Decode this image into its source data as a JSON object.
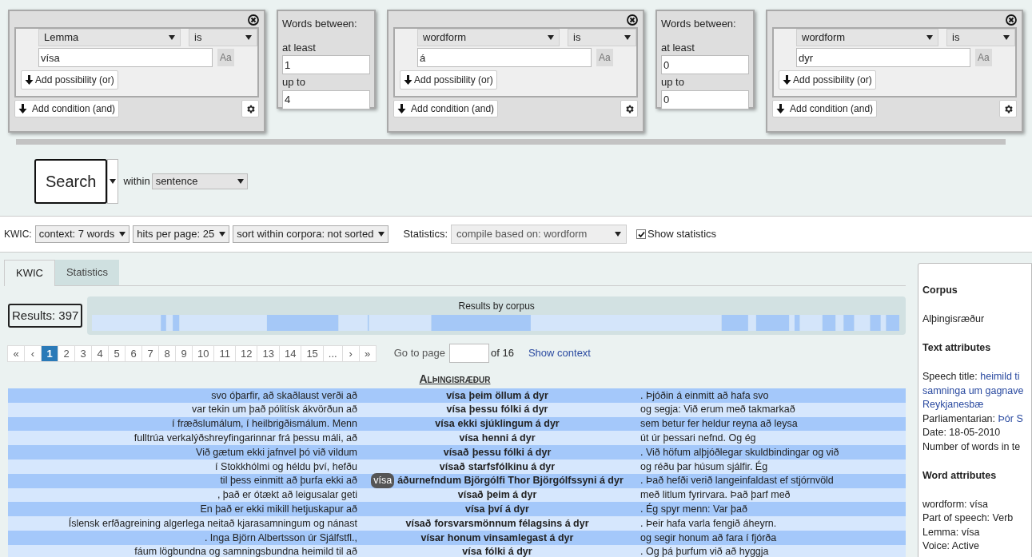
{
  "query": {
    "blocks": [
      {
        "kind": "token",
        "attribute": "Lemma",
        "operator": "is",
        "value": "vísa",
        "case_button": "Aa",
        "add_or": "Add possibility (or)",
        "add_and": "Add condition (and)"
      },
      {
        "kind": "between",
        "title": "Words between:",
        "min_label": "at least",
        "min": "1",
        "max_label": "up to",
        "max": "4"
      },
      {
        "kind": "token",
        "attribute": "wordform",
        "operator": "is",
        "value": "á",
        "case_button": "Aa",
        "add_or": "Add possibility (or)",
        "add_and": "Add condition (and)"
      },
      {
        "kind": "between",
        "title": "Words between:",
        "min_label": "at least",
        "min": "0",
        "max_label": "up to",
        "max": "0"
      },
      {
        "kind": "token",
        "attribute": "wordform",
        "operator": "is",
        "value": "dyr",
        "case_button": "Aa",
        "add_or": "Add possibility (or)",
        "add_and": "Add condition (and)"
      }
    ]
  },
  "search": {
    "button": "Search",
    "within_label": "within",
    "within": "sentence"
  },
  "toolbar": {
    "kwic_label": "KWIC:",
    "options": [
      "context: 7 words",
      "hits per page: 25",
      "sort within corpora: not sorted"
    ],
    "stats_label": "Statistics:",
    "stats_select": "compile based on: wordform",
    "show_stats": {
      "label": "Show statistics",
      "checked": true
    }
  },
  "tabs": [
    {
      "label": "KWIC",
      "selected": true
    },
    {
      "label": "Statistics",
      "selected": false
    }
  ],
  "results_count": "Results: 397",
  "corpus_bar_title": "Results by corpus",
  "pagination": {
    "pages": [
      {
        "label": "«",
        "selected": false
      },
      {
        "label": "‹",
        "selected": false
      },
      {
        "label": "1",
        "selected": true
      },
      {
        "label": "2",
        "selected": false
      },
      {
        "label": "3",
        "selected": false
      },
      {
        "label": "4",
        "selected": false
      },
      {
        "label": "5",
        "selected": false
      },
      {
        "label": "6",
        "selected": false
      },
      {
        "label": "7",
        "selected": false
      },
      {
        "label": "8",
        "selected": false
      },
      {
        "label": "9",
        "selected": false
      },
      {
        "label": "10",
        "selected": false
      },
      {
        "label": "11",
        "selected": false
      },
      {
        "label": "12",
        "selected": false
      },
      {
        "label": "13",
        "selected": false
      },
      {
        "label": "14",
        "selected": false
      },
      {
        "label": "15",
        "selected": false
      },
      {
        "label": "...",
        "selected": false
      },
      {
        "label": "›",
        "selected": false
      },
      {
        "label": "»",
        "selected": false
      }
    ],
    "goto_label": "Go to page",
    "of_label": "of 16",
    "show_context": "Show context"
  },
  "kwic": {
    "corpus_title": "Alþingisræður",
    "rows": [
      {
        "left": "svo óþarfir, að skaðlaust verði að",
        "hit_head": "vísa",
        "hit_tail": "þeim öllum á dyr",
        "right": ". Þjóðin á einmitt að hafa svo",
        "selected": false
      },
      {
        "left": "var tekin um það pólitísk ákvörðun að",
        "hit_head": "vísa",
        "hit_tail": "þessu fólki á dyr",
        "right": "og segja: Við erum með takmarkað",
        "selected": false
      },
      {
        "left": "í fræðslumálum, í heilbrigðismálum. Menn",
        "hit_head": "vísa",
        "hit_tail": "ekki sjúklingum á dyr",
        "right": "sem betur fer heldur reyna að leysa",
        "selected": false
      },
      {
        "left": "fulltrúa verkalýðshreyfingarinnar frá þessu máli, að",
        "hit_head": "vísa",
        "hit_tail": "henni á dyr",
        "right": "út úr þessari nefnd. Og ég",
        "selected": false
      },
      {
        "left": "Við gætum ekki jafnvel þó við vildum",
        "hit_head": "vísað",
        "hit_tail": "þessu fólki á dyr",
        "right": ". Við höfum alþjóðlegar skuldbindingar og við",
        "selected": false
      },
      {
        "left": "í Stokkhólmi og héldu því, hefðu",
        "hit_head": "vísað",
        "hit_tail": "starfsfólkinu á dyr",
        "right": "og réðu þar húsum sjálfir. Ég",
        "selected": false
      },
      {
        "left": "til þess einmitt að þurfa ekki að",
        "hit_head": "vísa",
        "hit_tail": "áðurnefndum Björgólfi Thor Björgólfssyni á dyr",
        "right": ". Það hefði verið langeinfaldast ef stjórnvöld",
        "selected": true
      },
      {
        "left": ", það er ótækt að leigusalar geti",
        "hit_head": "vísað",
        "hit_tail": "þeim á dyr",
        "right": "með litlum fyrirvara. Það þarf með",
        "selected": false
      },
      {
        "left": "En það er ekki mikill hetjuskapur að",
        "hit_head": "vísa",
        "hit_tail": "því á dyr",
        "right": ". Ég spyr menn: Var það",
        "selected": false
      },
      {
        "left": "Íslensk erfðagreining algerlega neitað kjarasamningum og nánast",
        "hit_head": "vísað",
        "hit_tail": "forsvarsmönnum félagsins á dyr",
        "right": ". Þeir hafa varla fengið áheyrn.",
        "selected": false
      },
      {
        "left": ". Inga Björn Albertsson úr Sjálfstfl.,",
        "hit_head": "vísar",
        "hit_tail": "honum vinsamlegast á dyr",
        "right": "og segir honum að fara í fjórða",
        "selected": false
      },
      {
        "left": "fáum lögbundna og samningsbundna heimild til að",
        "hit_head": "vísa",
        "hit_tail": "fólki á dyr",
        "right": ". Og þá þurfum við að hyggja",
        "selected": false
      }
    ]
  },
  "sidebar": {
    "sections": [
      {
        "heading": "Corpus",
        "lines": [
          {
            "label": "Alþingisræður"
          }
        ]
      },
      {
        "heading": "Text attributes",
        "lines": [
          {
            "label": "Speech title: ",
            "link": "heimild ti"
          },
          {
            "link": "samninga um gagnave"
          },
          {
            "link": "Reykjanesbæ"
          },
          {
            "label": "Parliamentarian: ",
            "link": "Þór S"
          },
          {
            "label": "Date: 18-05-2010"
          },
          {
            "label": "Number of words in te"
          }
        ]
      },
      {
        "heading": "Word attributes",
        "lines": [
          {
            "label": "wordform: vísa"
          },
          {
            "label": "Part of speech: Verb"
          },
          {
            "label": "Lemma: vísa"
          },
          {
            "label": "Voice: Active"
          }
        ]
      }
    ]
  }
}
